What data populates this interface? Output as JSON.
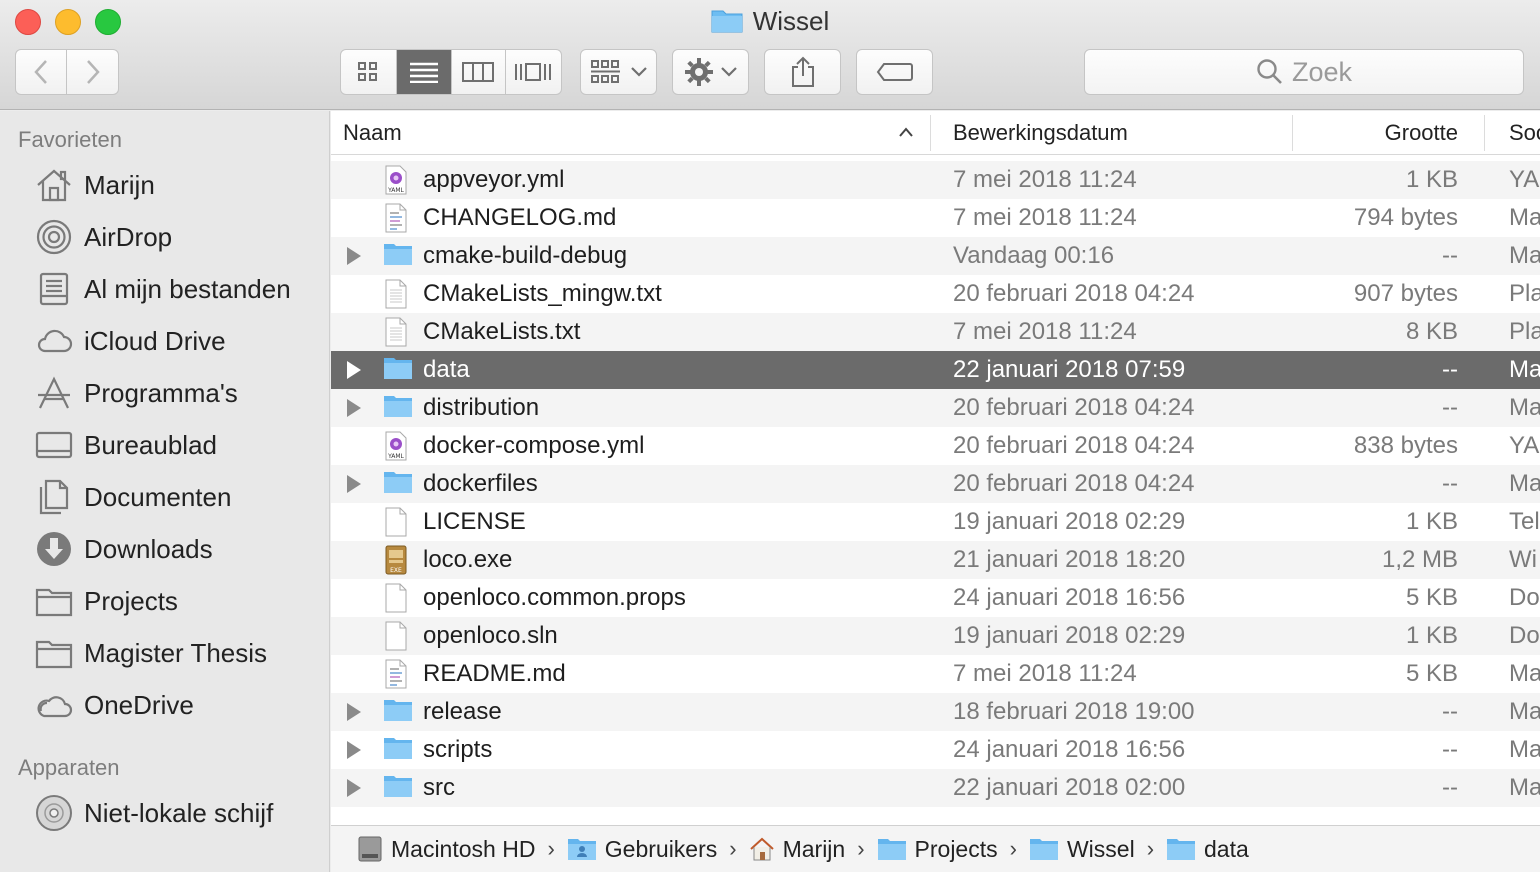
{
  "window": {
    "title": "Wissel"
  },
  "toolbar": {
    "view_modes": [
      "icon-view-icon",
      "list-view-icon",
      "column-view-icon",
      "coverflow-view-icon"
    ],
    "search_placeholder": "Zoek"
  },
  "sidebar": {
    "favorites_heading": "Favorieten",
    "favorites": [
      {
        "label": "Marijn",
        "icon": "home-icon"
      },
      {
        "label": "AirDrop",
        "icon": "airdrop-icon"
      },
      {
        "label": "Al mijn bestanden",
        "icon": "all-files-icon"
      },
      {
        "label": "iCloud Drive",
        "icon": "cloud-icon"
      },
      {
        "label": "Programma's",
        "icon": "applications-icon"
      },
      {
        "label": "Bureaublad",
        "icon": "desktop-icon"
      },
      {
        "label": "Documenten",
        "icon": "documents-icon"
      },
      {
        "label": "Downloads",
        "icon": "downloads-icon"
      },
      {
        "label": "Projects",
        "icon": "folder-icon"
      },
      {
        "label": "Magister Thesis",
        "icon": "folder-icon"
      },
      {
        "label": "OneDrive",
        "icon": "cloud-icon"
      }
    ],
    "devices_heading": "Apparaten",
    "devices": [
      {
        "label": "Niet-lokale schijf",
        "icon": "disc-icon"
      }
    ]
  },
  "columns": {
    "name": "Naam",
    "date": "Bewerkingsdatum",
    "size": "Grootte",
    "kind": "Soo"
  },
  "files": [
    {
      "name": "appveyor.yml",
      "date": "7 mei 2018 11:24",
      "size": "1 KB",
      "kind": "YA",
      "type": "yaml",
      "folder": false
    },
    {
      "name": "CHANGELOG.md",
      "date": "7 mei 2018 11:24",
      "size": "794 bytes",
      "kind": "Ma",
      "type": "text",
      "folder": false
    },
    {
      "name": "cmake-build-debug",
      "date": "Vandaag 00:16",
      "size": "--",
      "kind": "Ma",
      "type": "folder",
      "folder": true
    },
    {
      "name": "CMakeLists_mingw.txt",
      "date": "20 februari 2018 04:24",
      "size": "907 bytes",
      "kind": "Pla",
      "type": "plain",
      "folder": false
    },
    {
      "name": "CMakeLists.txt",
      "date": "7 mei 2018 11:24",
      "size": "8 KB",
      "kind": "Pla",
      "type": "plain",
      "folder": false
    },
    {
      "name": "data",
      "date": "22 januari 2018 07:59",
      "size": "--",
      "kind": "Ma",
      "type": "folder",
      "folder": true,
      "selected": true
    },
    {
      "name": "distribution",
      "date": "20 februari 2018 04:24",
      "size": "--",
      "kind": "Ma",
      "type": "folder",
      "folder": true
    },
    {
      "name": "docker-compose.yml",
      "date": "20 februari 2018 04:24",
      "size": "838 bytes",
      "kind": "YA",
      "type": "yaml",
      "folder": false
    },
    {
      "name": "dockerfiles",
      "date": "20 februari 2018 04:24",
      "size": "--",
      "kind": "Ma",
      "type": "folder",
      "folder": true
    },
    {
      "name": "LICENSE",
      "date": "19 januari 2018 02:29",
      "size": "1 KB",
      "kind": "Tel",
      "type": "blank",
      "folder": false
    },
    {
      "name": "loco.exe",
      "date": "21 januari 2018 18:20",
      "size": "1,2 MB",
      "kind": "Wi",
      "type": "exe",
      "folder": false
    },
    {
      "name": "openloco.common.props",
      "date": "24 januari 2018 16:56",
      "size": "5 KB",
      "kind": "Do",
      "type": "blank",
      "folder": false
    },
    {
      "name": "openloco.sln",
      "date": "19 januari 2018 02:29",
      "size": "1 KB",
      "kind": "Do",
      "type": "blank",
      "folder": false
    },
    {
      "name": "README.md",
      "date": "7 mei 2018 11:24",
      "size": "5 KB",
      "kind": "Ma",
      "type": "text",
      "folder": false
    },
    {
      "name": "release",
      "date": "18 februari 2018 19:00",
      "size": "--",
      "kind": "Ma",
      "type": "folder",
      "folder": true
    },
    {
      "name": "scripts",
      "date": "24 januari 2018 16:56",
      "size": "--",
      "kind": "Ma",
      "type": "folder",
      "folder": true
    },
    {
      "name": "src",
      "date": "22 januari 2018 02:00",
      "size": "--",
      "kind": "Ma",
      "type": "folder",
      "folder": true
    }
  ],
  "pathbar": [
    {
      "label": "Macintosh HD",
      "icon": "hard-drive-icon"
    },
    {
      "label": "Gebruikers",
      "icon": "users-folder-icon"
    },
    {
      "label": "Marijn",
      "icon": "home-icon"
    },
    {
      "label": "Projects",
      "icon": "folder-icon"
    },
    {
      "label": "Wissel",
      "icon": "folder-icon"
    },
    {
      "label": "data",
      "icon": "folder-icon"
    }
  ],
  "colors": {
    "selection": "#6b6b6b",
    "folder_blue": "#5fb6f0",
    "zebra": "#f4f4f4",
    "close": "#fc5f57",
    "minimize": "#fdbc2e",
    "zoom": "#28c840"
  }
}
